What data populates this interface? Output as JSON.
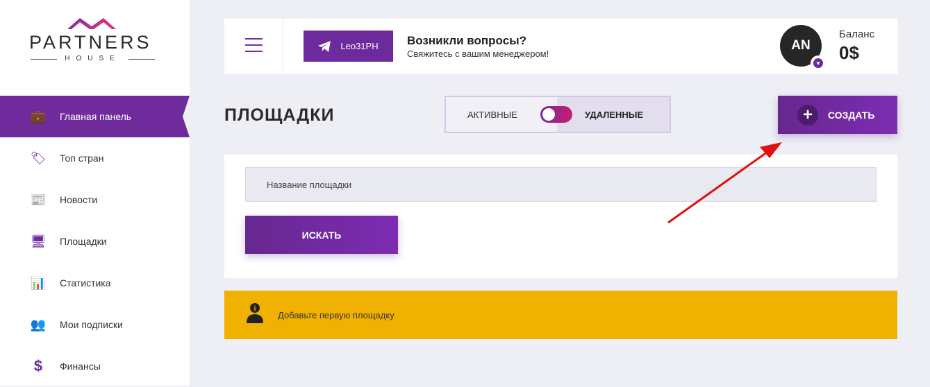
{
  "logo": {
    "word": "PARTNERS",
    "sub": "HOUSE"
  },
  "sidebar": {
    "items": [
      {
        "label": "Главная панель",
        "icon": "briefcase-icon",
        "glyph": "💼",
        "active": true
      },
      {
        "label": "Топ стран",
        "icon": "tag-icon",
        "glyph": "🏷"
      },
      {
        "label": "Новости",
        "icon": "newspaper-icon",
        "glyph": "📰"
      },
      {
        "label": "Площадки",
        "icon": "monitor-icon",
        "glyph": "🖥"
      },
      {
        "label": "Статистика",
        "icon": "bar-chart-icon",
        "glyph": "📊"
      },
      {
        "label": "Мои подписки",
        "icon": "users-icon",
        "glyph": "👥"
      },
      {
        "label": "Финансы",
        "icon": "dollar-icon",
        "glyph": "$"
      }
    ]
  },
  "header": {
    "telegram_label": "Leo31PH",
    "question_title": "Возникли вопросы?",
    "question_sub": "Свяжитесь с вашим менеджером!",
    "avatar_initials": "AN",
    "balance_label": "Баланс",
    "balance_value": "0$"
  },
  "main": {
    "title": "ПЛОЩАДКИ",
    "toggle_active": "АКТИВНЫЕ",
    "toggle_deleted": "УДАЛЕННЫЕ",
    "create_label": "СОЗДАТЬ",
    "search_placeholder": "Название площадки",
    "search_button": "ИСКАТЬ",
    "notice": "Добавьте первую площадку"
  },
  "colors": {
    "accent": "#6f2a9c",
    "notice": "#f1b100"
  }
}
